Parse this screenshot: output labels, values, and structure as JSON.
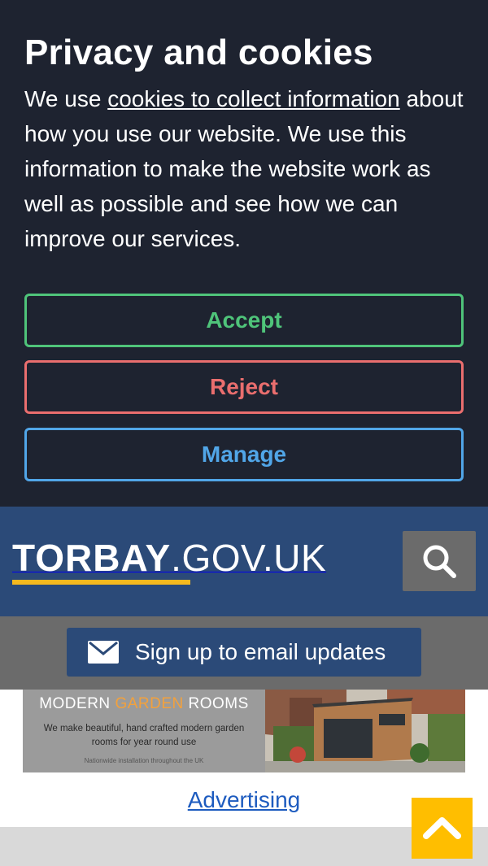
{
  "cookie_banner": {
    "title": "Privacy and cookies",
    "body_prefix": "We use ",
    "body_link": "cookies to collect information",
    "body_suffix": " about how you use our website. We use this information to make the website work as well as possible and see how we can improve our services.",
    "buttons": {
      "accept": "Accept",
      "reject": "Reject",
      "manage": "Manage"
    },
    "colors": {
      "background": "#1e2330",
      "accept": "#4fc47a",
      "reject": "#ea6e6e",
      "manage": "#51a6e8"
    }
  },
  "header": {
    "logo_bold": "TORBAY",
    "logo_light": ".GOV.UK",
    "search_icon": "search-icon",
    "colors": {
      "background": "#2b4a78",
      "logo_underline": "#f5b91e",
      "search_button": "#6b6b6b"
    }
  },
  "email_signup": {
    "label": "Sign up to email updates",
    "icon": "envelope-icon"
  },
  "ad": {
    "headline_part1": "MODERN ",
    "headline_accent": "GARDEN",
    "headline_part2": " ROOMS",
    "tagline": "We make beautiful, hand crafted modern garden rooms for year round use",
    "footnote": "Nationwide installation throughout the UK",
    "accent_color": "#f3a13c"
  },
  "advertising_link": "Advertising",
  "back_to_top": {
    "icon": "chevron-up-icon",
    "color": "#ffbe00"
  }
}
